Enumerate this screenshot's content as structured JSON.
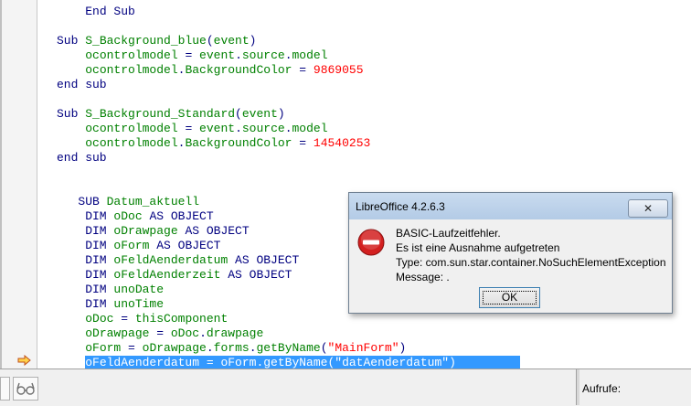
{
  "code_lines": [
    {
      "parts": [
        {
          "t": "    ",
          "c": ""
        },
        {
          "t": "End Sub",
          "c": "kw"
        }
      ]
    },
    {
      "parts": []
    },
    {
      "parts": [
        {
          "t": "Sub ",
          "c": "kw"
        },
        {
          "t": "S_Background_blue",
          "c": "id"
        },
        {
          "t": "(",
          "c": "kw"
        },
        {
          "t": "event",
          "c": "id"
        },
        {
          "t": ")",
          "c": "kw"
        }
      ]
    },
    {
      "parts": [
        {
          "t": "    ",
          "c": ""
        },
        {
          "t": "ocontrolmodel",
          "c": "id"
        },
        {
          "t": " = ",
          "c": "kw"
        },
        {
          "t": "event",
          "c": "id"
        },
        {
          "t": ".",
          "c": "kw"
        },
        {
          "t": "source",
          "c": "id"
        },
        {
          "t": ".",
          "c": "kw"
        },
        {
          "t": "model",
          "c": "id"
        }
      ]
    },
    {
      "parts": [
        {
          "t": "    ",
          "c": ""
        },
        {
          "t": "ocontrolmodel",
          "c": "id"
        },
        {
          "t": ".",
          "c": "kw"
        },
        {
          "t": "BackgroundColor",
          "c": "id"
        },
        {
          "t": " = ",
          "c": "kw"
        },
        {
          "t": "9869055",
          "c": "num"
        }
      ]
    },
    {
      "parts": [
        {
          "t": "end sub",
          "c": "kw"
        }
      ]
    },
    {
      "parts": []
    },
    {
      "parts": [
        {
          "t": "Sub ",
          "c": "kw"
        },
        {
          "t": "S_Background_Standard",
          "c": "id"
        },
        {
          "t": "(",
          "c": "kw"
        },
        {
          "t": "event",
          "c": "id"
        },
        {
          "t": ")",
          "c": "kw"
        }
      ]
    },
    {
      "parts": [
        {
          "t": "    ",
          "c": ""
        },
        {
          "t": "ocontrolmodel",
          "c": "id"
        },
        {
          "t": " = ",
          "c": "kw"
        },
        {
          "t": "event",
          "c": "id"
        },
        {
          "t": ".",
          "c": "kw"
        },
        {
          "t": "source",
          "c": "id"
        },
        {
          "t": ".",
          "c": "kw"
        },
        {
          "t": "model",
          "c": "id"
        }
      ]
    },
    {
      "parts": [
        {
          "t": "    ",
          "c": ""
        },
        {
          "t": "ocontrolmodel",
          "c": "id"
        },
        {
          "t": ".",
          "c": "kw"
        },
        {
          "t": "BackgroundColor",
          "c": "id"
        },
        {
          "t": " = ",
          "c": "kw"
        },
        {
          "t": "14540253",
          "c": "num"
        }
      ]
    },
    {
      "parts": [
        {
          "t": "end sub",
          "c": "kw"
        }
      ]
    },
    {
      "parts": []
    },
    {
      "parts": []
    },
    {
      "parts": [
        {
          "t": "   SUB ",
          "c": "kw"
        },
        {
          "t": "Datum_aktuell",
          "c": "id"
        }
      ]
    },
    {
      "parts": [
        {
          "t": "    DIM ",
          "c": "kw"
        },
        {
          "t": "oDoc",
          "c": "id"
        },
        {
          "t": " AS OBJECT",
          "c": "kw"
        }
      ]
    },
    {
      "parts": [
        {
          "t": "    DIM ",
          "c": "kw"
        },
        {
          "t": "oDrawpage",
          "c": "id"
        },
        {
          "t": " AS OBJECT",
          "c": "kw"
        }
      ]
    },
    {
      "parts": [
        {
          "t": "    DIM ",
          "c": "kw"
        },
        {
          "t": "oForm",
          "c": "id"
        },
        {
          "t": " AS OBJECT",
          "c": "kw"
        }
      ]
    },
    {
      "parts": [
        {
          "t": "    DIM ",
          "c": "kw"
        },
        {
          "t": "oFeldAenderdatum",
          "c": "id"
        },
        {
          "t": " AS OBJECT",
          "c": "kw"
        }
      ]
    },
    {
      "parts": [
        {
          "t": "    DIM ",
          "c": "kw"
        },
        {
          "t": "oFeldAenderzeit",
          "c": "id"
        },
        {
          "t": " AS OBJECT",
          "c": "kw"
        }
      ]
    },
    {
      "parts": [
        {
          "t": "    DIM ",
          "c": "kw"
        },
        {
          "t": "unoDate",
          "c": "id"
        }
      ]
    },
    {
      "parts": [
        {
          "t": "    DIM ",
          "c": "kw"
        },
        {
          "t": "unoTime",
          "c": "id"
        }
      ]
    },
    {
      "parts": [
        {
          "t": "    ",
          "c": ""
        },
        {
          "t": "oDoc",
          "c": "id"
        },
        {
          "t": " = ",
          "c": "kw"
        },
        {
          "t": "thisComponent",
          "c": "id"
        }
      ]
    },
    {
      "parts": [
        {
          "t": "    ",
          "c": ""
        },
        {
          "t": "oDrawpage",
          "c": "id"
        },
        {
          "t": " = ",
          "c": "kw"
        },
        {
          "t": "oDoc",
          "c": "id"
        },
        {
          "t": ".",
          "c": "kw"
        },
        {
          "t": "drawpage",
          "c": "id"
        }
      ]
    },
    {
      "parts": [
        {
          "t": "    ",
          "c": ""
        },
        {
          "t": "oForm",
          "c": "id"
        },
        {
          "t": " = ",
          "c": "kw"
        },
        {
          "t": "oDrawpage",
          "c": "id"
        },
        {
          "t": ".",
          "c": "kw"
        },
        {
          "t": "forms",
          "c": "id"
        },
        {
          "t": ".",
          "c": "kw"
        },
        {
          "t": "getByName",
          "c": "id"
        },
        {
          "t": "(",
          "c": "kw"
        },
        {
          "t": "\"MainForm\"",
          "c": "str"
        },
        {
          "t": ")",
          "c": "kw"
        }
      ]
    },
    {
      "highlight": true,
      "parts": [
        {
          "t": "    ",
          "c": ""
        },
        {
          "t": "oFeldAenderdatum = oForm.getByName(\"datAenderdatum\")         ",
          "c": "hlt"
        }
      ]
    }
  ],
  "calls_label": "Aufrufe:",
  "dialog": {
    "title": "LibreOffice 4.2.6.3",
    "close_label": "✕",
    "message_lines": [
      "BASIC-Laufzeitfehler.",
      "Es ist eine Ausnahme aufgetreten",
      "Type: com.sun.star.container.NoSuchElementException",
      "Message: ."
    ],
    "ok_label": "OK"
  },
  "icons": {
    "error": "error-icon",
    "exec_marker": "current-line-arrow-icon",
    "watch": "watch-glasses-icon"
  },
  "colors": {
    "keyword": "#000080",
    "identifier": "#008000",
    "literal": "#ff0000",
    "selection": "#3399ff"
  }
}
